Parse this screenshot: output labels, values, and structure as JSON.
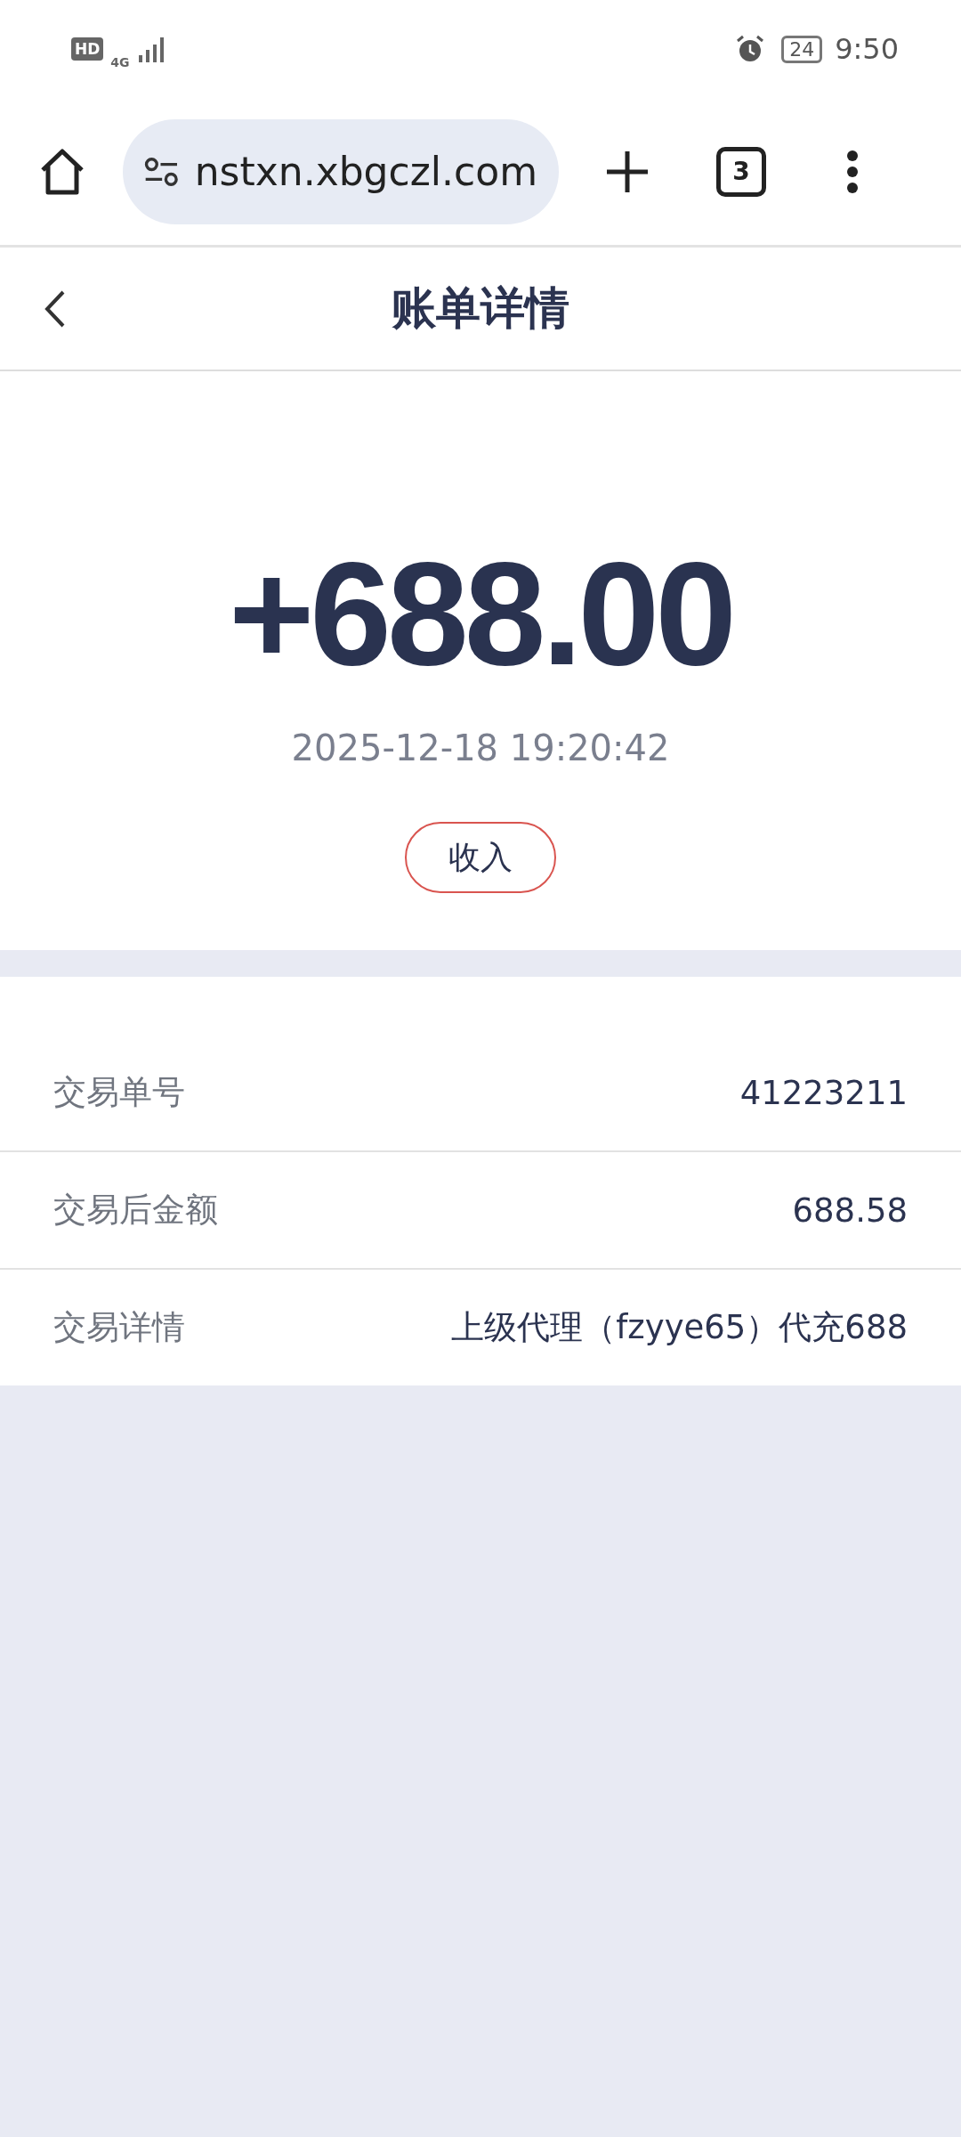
{
  "status_bar": {
    "hd": "HD",
    "network": "4G",
    "battery": "24",
    "time": "9:50"
  },
  "browser": {
    "url": "nstxn.xbgczl.com",
    "tab_count": "3"
  },
  "header": {
    "title": "账单详情"
  },
  "summary": {
    "amount": "+688.00",
    "datetime": "2025-12-18 19:20:42",
    "tag": "收入"
  },
  "details": [
    {
      "label": "交易单号",
      "value": "41223211"
    },
    {
      "label": "交易后金额",
      "value": "688.58"
    },
    {
      "label": "交易详情",
      "value": "上级代理（fzyye65）代充688"
    }
  ]
}
